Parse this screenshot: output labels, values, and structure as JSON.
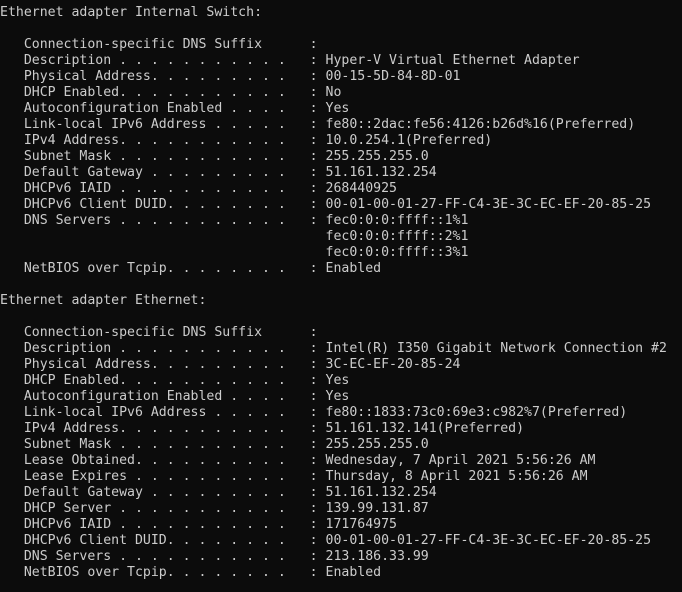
{
  "terminal": {
    "kind": "windows-console",
    "command_output": "ipconfig /all",
    "background_color": "#0c0c0c",
    "foreground_color": "#cccccc",
    "label_column_width": 36,
    "value_column": 38,
    "indent": "   "
  },
  "sections": [
    {
      "heading": "Ethernet adapter Internal Switch:",
      "rows": [
        {
          "label": "Connection-specific DNS Suffix  ",
          "value": ""
        },
        {
          "label": "Description . . . . . . . . . . .",
          "value": "Hyper-V Virtual Ethernet Adapter"
        },
        {
          "label": "Physical Address. . . . . . . . .",
          "value": "00-15-5D-84-8D-01"
        },
        {
          "label": "DHCP Enabled. . . . . . . . . . .",
          "value": "No"
        },
        {
          "label": "Autoconfiguration Enabled . . . .",
          "value": "Yes"
        },
        {
          "label": "Link-local IPv6 Address . . . . .",
          "value": "fe80::2dac:fe56:4126:b26d%16(Preferred)"
        },
        {
          "label": "IPv4 Address. . . . . . . . . . .",
          "value": "10.0.254.1(Preferred)"
        },
        {
          "label": "Subnet Mask . . . . . . . . . . .",
          "value": "255.255.255.0"
        },
        {
          "label": "Default Gateway . . . . . . . . .",
          "value": "51.161.132.254"
        },
        {
          "label": "DHCPv6 IAID . . . . . . . . . . .",
          "value": "268440925"
        },
        {
          "label": "DHCPv6 Client DUID. . . . . . . .",
          "value": "00-01-00-01-27-FF-C4-3E-3C-EC-EF-20-85-25"
        },
        {
          "label": "DNS Servers . . . . . . . . . . .",
          "value": "fec0:0:0:ffff::1%1"
        },
        {
          "label": "",
          "value": "fec0:0:0:ffff::2%1"
        },
        {
          "label": "",
          "value": "fec0:0:0:ffff::3%1"
        },
        {
          "label": "NetBIOS over Tcpip. . . . . . . .",
          "value": "Enabled"
        }
      ]
    },
    {
      "heading": "Ethernet adapter Ethernet:",
      "rows": [
        {
          "label": "Connection-specific DNS Suffix  ",
          "value": ""
        },
        {
          "label": "Description . . . . . . . . . . .",
          "value": "Intel(R) I350 Gigabit Network Connection #2"
        },
        {
          "label": "Physical Address. . . . . . . . .",
          "value": "3C-EC-EF-20-85-24"
        },
        {
          "label": "DHCP Enabled. . . . . . . . . . .",
          "value": "Yes"
        },
        {
          "label": "Autoconfiguration Enabled . . . .",
          "value": "Yes"
        },
        {
          "label": "Link-local IPv6 Address . . . . .",
          "value": "fe80::1833:73c0:69e3:c982%7(Preferred)"
        },
        {
          "label": "IPv4 Address. . . . . . . . . . .",
          "value": "51.161.132.141(Preferred)"
        },
        {
          "label": "Subnet Mask . . . . . . . . . . .",
          "value": "255.255.255.0"
        },
        {
          "label": "Lease Obtained. . . . . . . . . .",
          "value": "Wednesday, 7 April 2021 5:56:26 AM"
        },
        {
          "label": "Lease Expires . . . . . . . . . .",
          "value": "Thursday, 8 April 2021 5:56:26 AM"
        },
        {
          "label": "Default Gateway . . . . . . . . .",
          "value": "51.161.132.254"
        },
        {
          "label": "DHCP Server . . . . . . . . . . .",
          "value": "139.99.131.87"
        },
        {
          "label": "DHCPv6 IAID . . . . . . . . . . .",
          "value": "171764975"
        },
        {
          "label": "DHCPv6 Client DUID. . . . . . . .",
          "value": "00-01-00-01-27-FF-C4-3E-3C-EC-EF-20-85-25"
        },
        {
          "label": "DNS Servers . . . . . . . . . . .",
          "value": "213.186.33.99"
        },
        {
          "label": "NetBIOS over Tcpip. . . . . . . .",
          "value": "Enabled"
        }
      ]
    }
  ]
}
